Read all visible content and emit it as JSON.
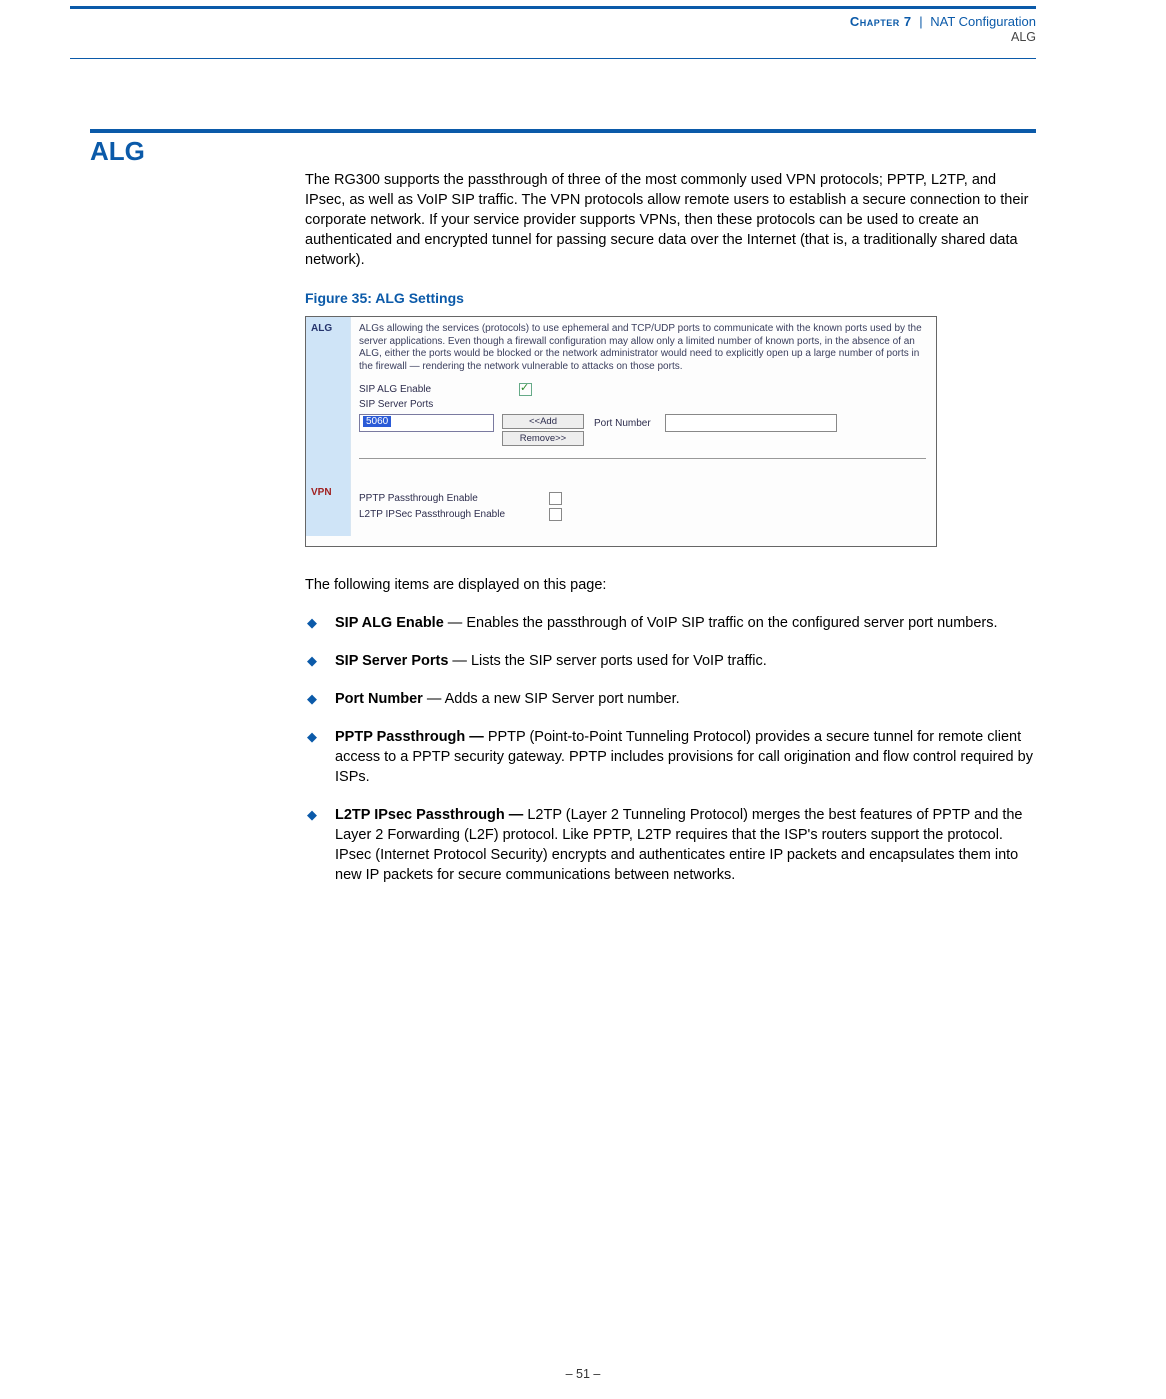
{
  "header": {
    "chapter_label": "Chapter 7",
    "separator": "|",
    "chapter_title": "NAT Configuration",
    "sub": "ALG"
  },
  "section": {
    "title": "ALG"
  },
  "intro": "The RG300 supports the passthrough of three of the most commonly used VPN protocols; PPTP, L2TP, and IPsec, as well as VoIP SIP traffic. The VPN protocols allow remote users to establish a secure connection to their corporate network. If your service provider supports VPNs, then these protocols can be used to create an authenticated and encrypted tunnel for passing secure data over the Internet (that is, a traditionally shared data network).",
  "figure": {
    "caption": "Figure 35:  ALG Settings",
    "side_alg": "ALG",
    "side_vpn": "VPN",
    "desc": "ALGs allowing the services (protocols) to use ephemeral and TCP/UDP ports to communicate with the known ports used by the server applications. Even though a firewall configuration may allow only a limited number of known ports, in the absence of an ALG, either the ports would be blocked or the network administrator would need to explicitly open up a large number of ports in the firewall — rendering the network vulnerable to attacks on those ports.",
    "sip_alg_label": "SIP ALG Enable",
    "sip_ports_label": "SIP Server Ports",
    "sip_port_value": "5060",
    "btn_add": "<<Add",
    "btn_remove": "Remove>>",
    "port_number_label": "Port Number",
    "pptp_label": "PPTP Passthrough Enable",
    "l2tp_label": "L2TP IPSec Passthrough Enable"
  },
  "follow": "The following items are displayed on this page:",
  "bullets": [
    {
      "term": "SIP ALG Enable",
      "sep": " — ",
      "desc": "Enables the passthrough of VoIP SIP traffic on the configured server port numbers."
    },
    {
      "term": "SIP Server Ports",
      "sep": " — ",
      "desc": "Lists the SIP server ports used for VoIP traffic."
    },
    {
      "term": "Port Number",
      "sep": " — ",
      "desc": "Adds a new SIP Server port number."
    },
    {
      "term": "PPTP Passthrough —",
      "sep": " ",
      "desc": "PPTP (Point-to-Point Tunneling Protocol) provides a secure tunnel for remote client access to a PPTP security gateway. PPTP includes provisions for call origination and flow control required by ISPs."
    },
    {
      "term": "L2TP IPsec Passthrough —",
      "sep": "  ",
      "desc": "L2TP (Layer 2 Tunneling Protocol) merges the best features of PPTP and the Layer 2 Forwarding (L2F) protocol. Like PPTP, L2TP requires that the ISP's routers support the protocol. IPsec (Internet Protocol Security) encrypts and authenticates entire IP packets and encapsulates them into new IP packets for secure communications between networks."
    }
  ],
  "footer": {
    "page": "–  51  –"
  }
}
